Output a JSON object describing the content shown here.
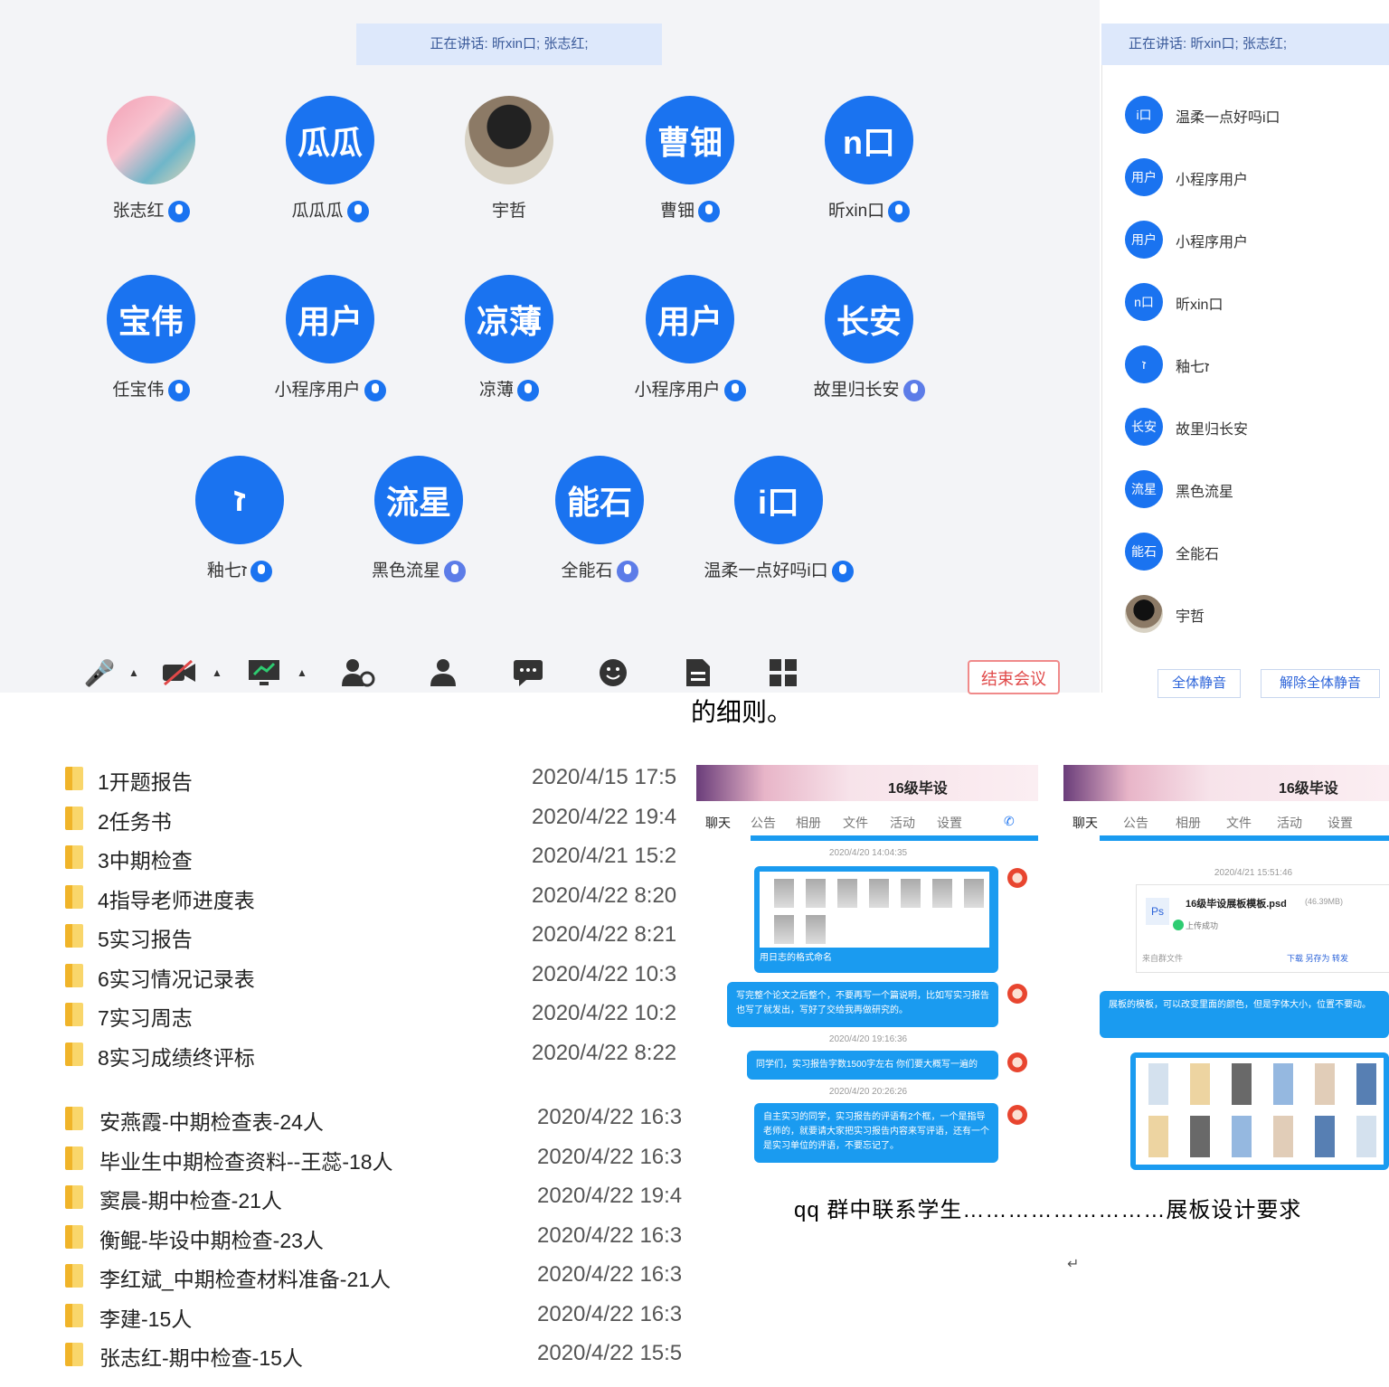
{
  "meeting": {
    "speaking_banner": "正在讲话: 昕xin口; 张志红;",
    "participants": [
      {
        "avatar": "",
        "name": "张志红"
      },
      {
        "avatar": "瓜瓜",
        "name": "瓜瓜瓜"
      },
      {
        "avatar": "",
        "name": "宇哲"
      },
      {
        "avatar": "曹钿",
        "name": "曹钿"
      },
      {
        "avatar": "n口",
        "name": "昕xin口"
      },
      {
        "avatar": "宝伟",
        "name": "任宝伟"
      },
      {
        "avatar": "用户",
        "name": "小程序用户"
      },
      {
        "avatar": "凉薄",
        "name": "凉薄"
      },
      {
        "avatar": "用户",
        "name": "小程序用户"
      },
      {
        "avatar": "长安",
        "name": "故里归长安"
      },
      {
        "avatar": "ז",
        "name": "釉七ז"
      },
      {
        "avatar": "流星",
        "name": "黑色流星"
      },
      {
        "avatar": "能石",
        "name": "全能石"
      },
      {
        "avatar": "i口",
        "name": "温柔一点好吗i口"
      }
    ],
    "end_button": "结束会议",
    "toolbar_icons": [
      "microphone-icon",
      "camera-off-icon",
      "screen-share-icon",
      "add-member-icon",
      "members-icon",
      "chat-icon",
      "emoji-icon",
      "document-icon",
      "apps-icon"
    ]
  },
  "panel": {
    "speaking_banner": "正在讲话: 昕xin口; 张志红;",
    "members": [
      {
        "avatar": "i口",
        "name": "温柔一点好吗i口"
      },
      {
        "avatar": "用户",
        "name": "小程序用户"
      },
      {
        "avatar": "用户",
        "name": "小程序用户"
      },
      {
        "avatar": "n口",
        "name": "昕xin口"
      },
      {
        "avatar": "ז",
        "name": "釉七ז"
      },
      {
        "avatar": "长安",
        "name": "故里归长安"
      },
      {
        "avatar": "流星",
        "name": "黑色流星"
      },
      {
        "avatar": "能石",
        "name": "全能石"
      },
      {
        "avatar": "",
        "name": "宇哲"
      }
    ],
    "mute_all": "全体静音",
    "unmute_all": "解除全体静音"
  },
  "caption_top": "的细则。",
  "files_a": [
    {
      "name": "1开题报告",
      "date": "2020/4/15 17:5"
    },
    {
      "name": "2任务书",
      "date": "2020/4/22 19:4"
    },
    {
      "name": "3中期检查",
      "date": "2020/4/21 15:2"
    },
    {
      "name": "4指导老师进度表",
      "date": "2020/4/22 8:20"
    },
    {
      "name": "5实习报告",
      "date": "2020/4/22 8:21"
    },
    {
      "name": "6实习情况记录表",
      "date": "2020/4/22 10:3"
    },
    {
      "name": "7实习周志",
      "date": "2020/4/22 10:2"
    },
    {
      "name": "8实习成绩终评标",
      "date": "2020/4/22 8:22"
    }
  ],
  "files_b": [
    {
      "name": "安燕霞-中期检查表-24人",
      "date": "2020/4/22 16:3"
    },
    {
      "name": "毕业生中期检查资料--王蕊-18人",
      "date": "2020/4/22 16:3"
    },
    {
      "name": "窦晨-期中检查-21人",
      "date": "2020/4/22 19:4"
    },
    {
      "name": "衡鲲-毕设中期检查-23人",
      "date": "2020/4/22 16:3"
    },
    {
      "name": "李红斌_中期检查材料准备-21人",
      "date": "2020/4/22 16:3"
    },
    {
      "name": "李建-15人",
      "date": "2020/4/22 16:3"
    },
    {
      "name": "张志红-期中检查-15人",
      "date": "2020/4/22 15:5"
    }
  ],
  "qq1": {
    "group": "16级毕设",
    "tabs": [
      "聊天",
      "公告",
      "相册",
      "文件",
      "活动",
      "设置"
    ],
    "times": [
      "2020/4/20 14:04:35",
      "2020/4/20 19:16:36",
      "2020/4/20 20:26:26"
    ],
    "img_caption": "用日志的格式命名",
    "msg1": "写完整个论文之后整个，不要再写一个篇说明，比如写实习报告也写了就发出，写好了交给我再做研究的。",
    "msg2": "同学们，实习报告字数1500字左右 你们要大概写一遍的",
    "msg3": "自主实习的同学，实习报告的评语有2个框，一个是指导老师的，就要请大家把实习报告内容来写评语，还有一个是实习单位的评语，不要忘记了。"
  },
  "qq2": {
    "group": "16级毕设",
    "tabs": [
      "聊天",
      "公告",
      "相册",
      "文件",
      "活动",
      "设置"
    ],
    "time": "2020/4/21 15:51:46",
    "file_name": "16级毕设展板模板.psd",
    "file_size": "(46.39MB)",
    "file_status": "上传成功",
    "file_src": "来自群文件",
    "file_actions": "下载  另存为  转发",
    "msg": "展板的模板，可以改变里面的颜色，但是字体大小，位置不要动。"
  },
  "caption_bottom": "qq 群中联系学生………………………展板设计要求"
}
